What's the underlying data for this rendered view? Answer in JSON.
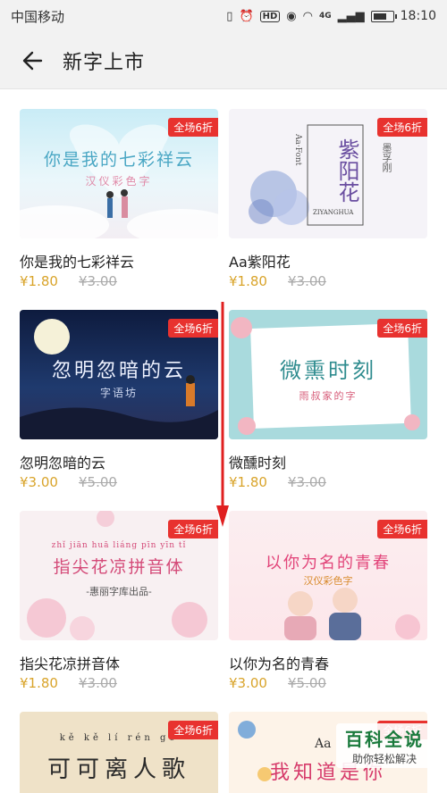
{
  "status_bar": {
    "carrier": "中国移动",
    "network": "4G",
    "time": "18:10"
  },
  "header": {
    "title": "新字上市"
  },
  "badge_text": "全场6折",
  "fonts": [
    {
      "name": "你是我的七彩祥云",
      "price": "¥1.80",
      "old_price": "¥3.00",
      "preview_title": "你是我的七彩祥云",
      "preview_sub": "汉仪彩色字"
    },
    {
      "name": "Aa紫阳花",
      "price": "¥1.80",
      "old_price": "¥3.00",
      "preview_title": "紫阳花",
      "preview_sub": "Aa·Font",
      "preview_side": "墨孚刚",
      "preview_foot": "ZIYANGHUA"
    },
    {
      "name": "忽明忽暗的云",
      "price": "¥3.00",
      "old_price": "¥5.00",
      "preview_title": "忽明忽暗的云",
      "preview_sub": "字语坊"
    },
    {
      "name": "微醺时刻",
      "price": "¥1.80",
      "old_price": "¥3.00",
      "preview_title": "微熏时刻",
      "preview_sub": "雨叔家的字"
    },
    {
      "name": "指尖花凉拼音体",
      "price": "¥1.80",
      "old_price": "¥3.00",
      "preview_title": "指尖花凉拼音体",
      "preview_pinyin": "zhǐ jiān huā liáng pīn yīn tǐ",
      "preview_sub": "-惠丽字库出品-"
    },
    {
      "name": "以你为名的青春",
      "price": "¥3.00",
      "old_price": "¥5.00",
      "preview_title": "以你为名的青春",
      "preview_sub": "汉仪彩色字"
    },
    {
      "name": "",
      "price": "",
      "old_price": "",
      "preview_title": "可可离人歌",
      "preview_pinyin": "kě kě lí rén gē"
    },
    {
      "name": "",
      "price": "",
      "old_price": "",
      "preview_title": "我知道是你",
      "preview_sub": "Aa"
    }
  ],
  "watermark": {
    "title": "百科全说",
    "subtitle": "助你轻松解决"
  },
  "colors": {
    "badge": "#e8322f",
    "price": "#d9a42b",
    "watermark": "#1a7a3c",
    "arrow": "#e02020"
  }
}
